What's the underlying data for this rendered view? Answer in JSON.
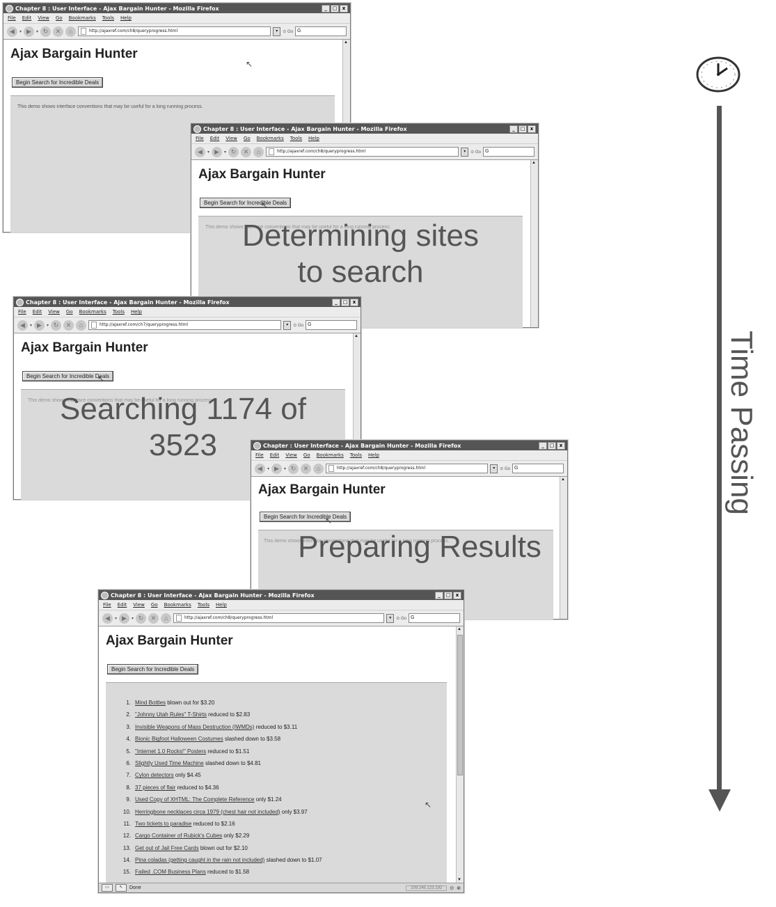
{
  "browser": {
    "window_title": "Chapter 8 : User Interface - Ajax Bargain Hunter - Mozilla Firefox",
    "window_title_4": "Chapter   : User Interface - Ajax Bargain Hunter - Mozilla Firefox",
    "menu": [
      "File",
      "Edit",
      "View",
      "Go",
      "Bookmarks",
      "Tools",
      "Help"
    ],
    "url_ch8": "http://ajaxref.com/ch8/queryprogress.html",
    "url_ch7": "http://ajaxref.com/ch7/queryprogress.html",
    "min": "_",
    "max": "□",
    "close": "x",
    "go_label": "Go",
    "search_glyph": "G"
  },
  "page": {
    "title": "Ajax Bargain Hunter",
    "button": "Begin Search for Incredible Deals",
    "demo_text": "This demo shows interface conventions that may be useful for a long running process."
  },
  "stages": {
    "s2": "Determining sites to search",
    "s3": "Searching 1174 of 3523",
    "s4": "Preparing Results"
  },
  "results": [
    {
      "n": "1.",
      "link": "Mind Bottles",
      "rest": " blown out for $3.20"
    },
    {
      "n": "2.",
      "link": "\"Johnny Utah Rules\" T-Shirts",
      "rest": " reduced to $2.83"
    },
    {
      "n": "3.",
      "link": "Invisible Weapons of Mass Destruction (IWMDs)",
      "rest": " reduced to $3.11"
    },
    {
      "n": "4.",
      "link": "Bionic Bigfoot Halloween Costumes",
      "rest": " slashed down to $3.58"
    },
    {
      "n": "5.",
      "link": "\"Internet 1.0 Rocks!\" Posters",
      "rest": " reduced to $1.51"
    },
    {
      "n": "6.",
      "link": "Slightly Used Time Machine",
      "rest": " slashed down to $4.81"
    },
    {
      "n": "7.",
      "link": "Cylon detectors",
      "rest": " only $4.45"
    },
    {
      "n": "8.",
      "link": "37 pieces of flair",
      "rest": " reduced to $4.36"
    },
    {
      "n": "9.",
      "link": "Used Copy of XHTML: The Complete Reference",
      "rest": " only $1.24"
    },
    {
      "n": "10.",
      "link": "Herringbone necklaces circa 1979 (chest hair not included)",
      "rest": " only $3.97"
    },
    {
      "n": "11.",
      "link": "Two tickets to paradise",
      "rest": " reduced to $2.16"
    },
    {
      "n": "12.",
      "link": "Cargo Container of Rubick's Cubes",
      "rest": " only $2.29"
    },
    {
      "n": "13.",
      "link": "Get out of Jail Free Cards",
      "rest": " blown out for $2.10"
    },
    {
      "n": "14.",
      "link": "Pina coladas (getting caught in the rain not included)",
      "rest": " slashed down to $1.07"
    },
    {
      "n": "15.",
      "link": "Failed .COM Business Plans",
      "rest": " reduced to $1.58"
    }
  ],
  "status": {
    "done": "Done",
    "ip": "209.245.123.192"
  },
  "timeline": {
    "label": "Time Passing"
  }
}
